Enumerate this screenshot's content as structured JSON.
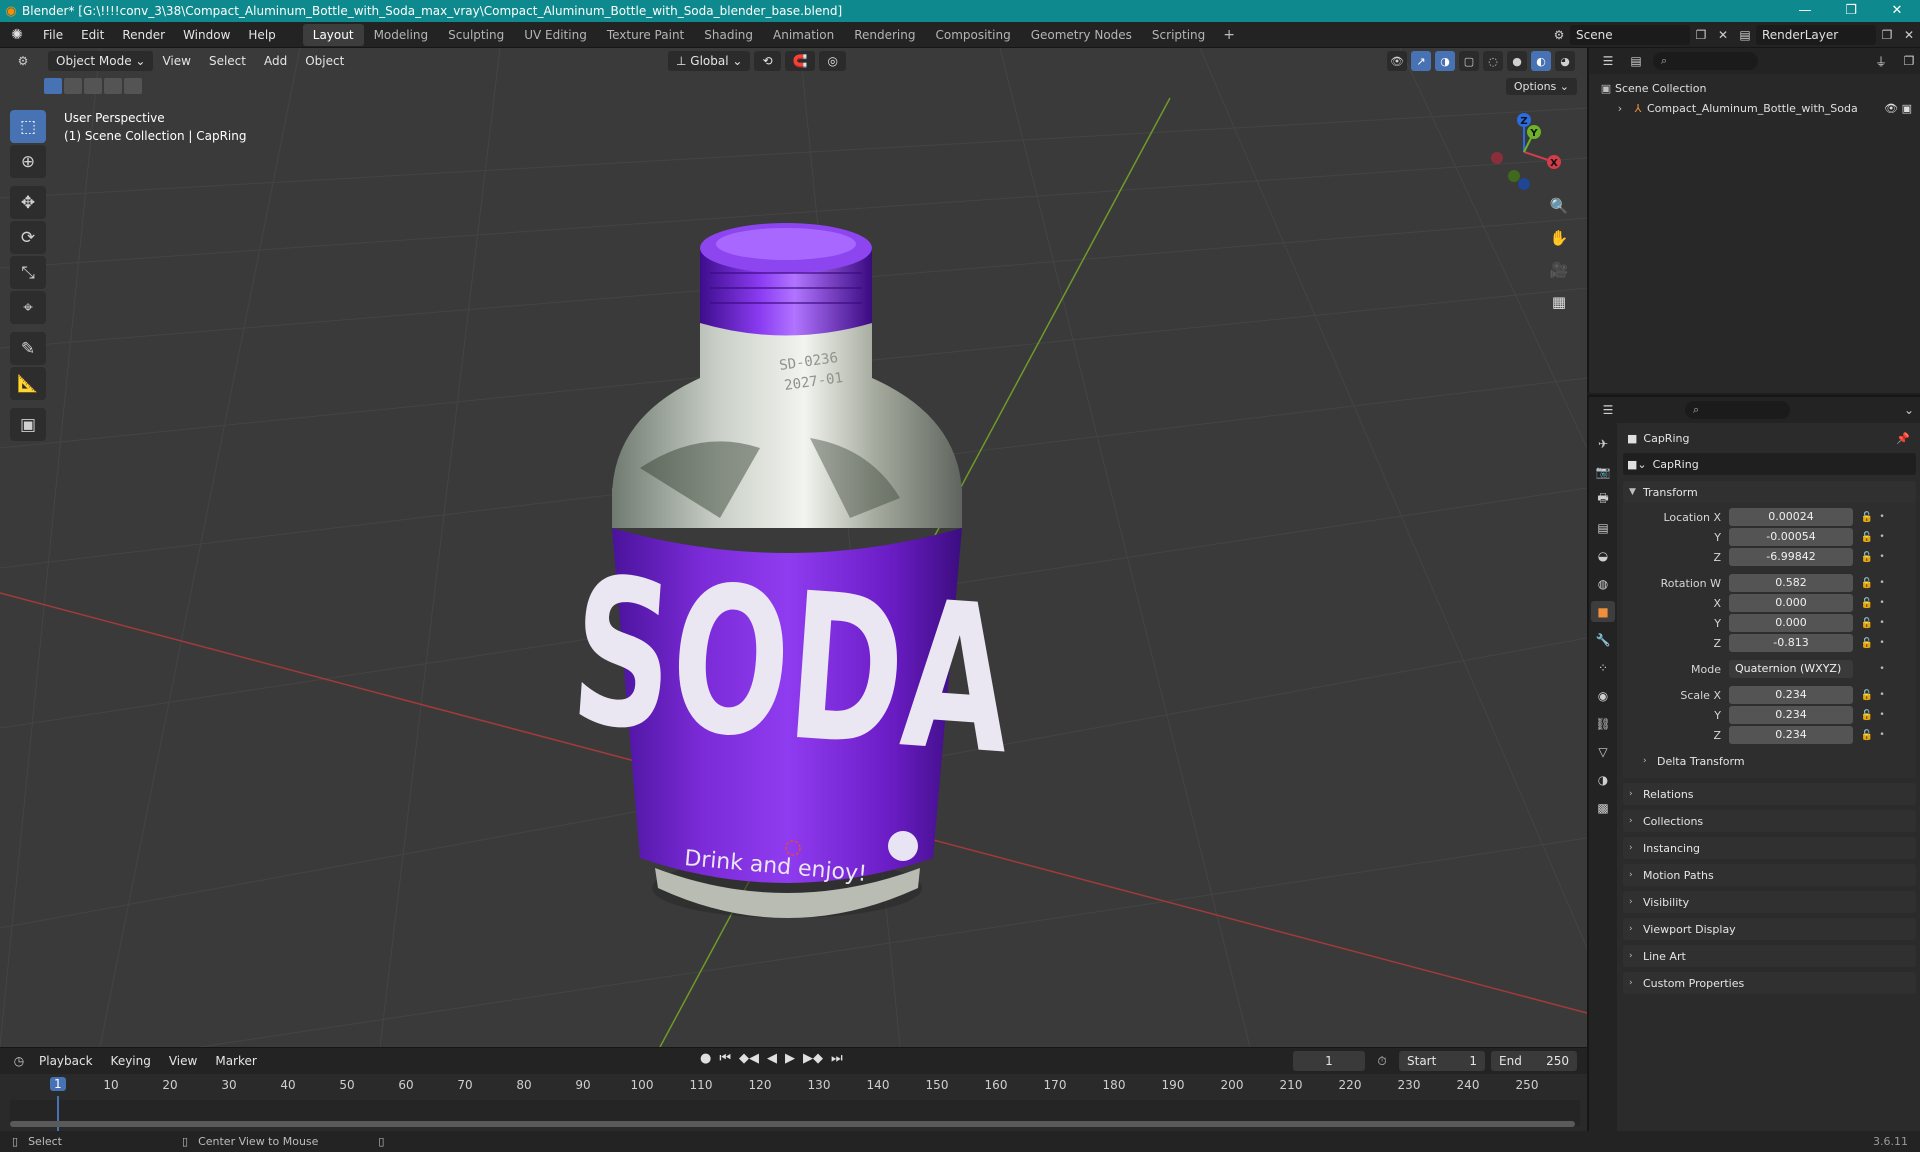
{
  "window": {
    "title": "Blender* [G:\\!!!!conv_3\\38\\Compact_Aluminum_Bottle_with_Soda_max_vray\\Compact_Aluminum_Bottle_with_Soda_blender_base.blend]",
    "controls": [
      "—",
      "❐",
      "✕"
    ]
  },
  "menu": [
    "File",
    "Edit",
    "Render",
    "Window",
    "Help"
  ],
  "workspaces": [
    "Layout",
    "Modeling",
    "Sculpting",
    "UV Editing",
    "Texture Paint",
    "Shading",
    "Animation",
    "Rendering",
    "Compositing",
    "Geometry Nodes",
    "Scripting"
  ],
  "workspace_add": "+",
  "scene": {
    "name": "Scene",
    "render_layer": "RenderLayer"
  },
  "viewport": {
    "mode": "Object Mode",
    "menus": [
      "View",
      "Select",
      "Add",
      "Object"
    ],
    "orientation": "Global",
    "options": "Options",
    "perspective": "User Perspective",
    "collection_info": "(1) Scene Collection | CapRing",
    "gizmo_axes": {
      "x": "X",
      "y": "Y",
      "z": "Z"
    },
    "label_brand": "SODA",
    "label_slogan": "Drink and enjoy!",
    "neck_print_1": "SD-0236",
    "neck_print_2": "2027-01"
  },
  "outliner": {
    "search_placeholder": "",
    "scene_collection": "Scene Collection",
    "object": "Compact_Aluminum_Bottle_with_Soda"
  },
  "properties": {
    "object_name": "CapRing",
    "data_name": "CapRing",
    "transform_label": "Transform",
    "location": {
      "label": "Location X",
      "x": "0.00024",
      "y": "-0.00054",
      "z": "-6.99842"
    },
    "rotation": {
      "label": "Rotation W",
      "w": "0.582",
      "x": "0.000",
      "y": "0.000",
      "z": "-0.813"
    },
    "mode_label": "Mode",
    "mode_value": "Quaternion (WXYZ)",
    "scale": {
      "label": "Scale X",
      "x": "0.234",
      "y": "0.234",
      "z": "0.234"
    },
    "axis_y": "Y",
    "axis_z": "Z",
    "axis_x": "X",
    "delta_transform": "Delta Transform",
    "panels": [
      "Relations",
      "Collections",
      "Instancing",
      "Motion Paths",
      "Visibility",
      "Viewport Display",
      "Line Art",
      "Custom Properties"
    ]
  },
  "timeline": {
    "menus": [
      "Playback",
      "Keying",
      "View",
      "Marker"
    ],
    "current_frame": "1",
    "start_label": "Start",
    "start_value": "1",
    "end_label": "End",
    "end_value": "250",
    "ruler_ticks": [
      "10",
      "20",
      "30",
      "40",
      "50",
      "60",
      "70",
      "80",
      "90",
      "100",
      "110",
      "120",
      "130",
      "140",
      "150",
      "160",
      "170",
      "180",
      "190",
      "200",
      "210",
      "220",
      "230",
      "240",
      "250"
    ],
    "ruler_current": "1"
  },
  "statusbar": {
    "select": "Select",
    "center": "Center View to Mouse",
    "version": "3.6.11"
  }
}
